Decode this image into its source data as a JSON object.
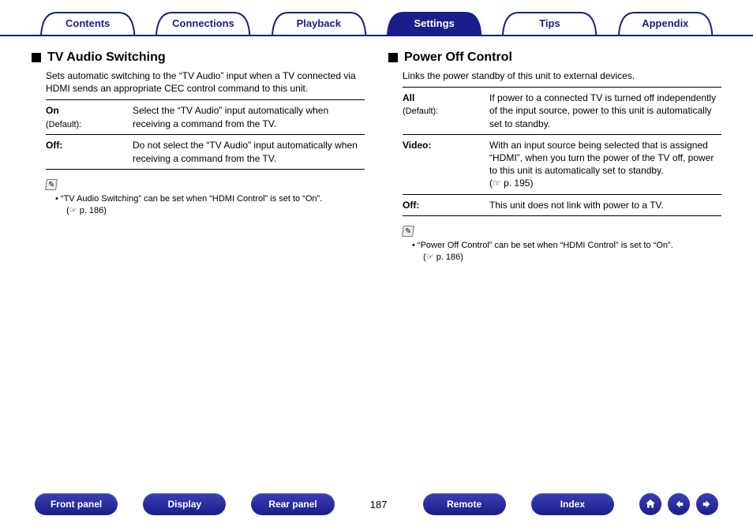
{
  "tabs": {
    "contents": "Contents",
    "connections": "Connections",
    "playback": "Playback",
    "settings": "Settings",
    "tips": "Tips",
    "appendix": "Appendix"
  },
  "left": {
    "title": "TV Audio Switching",
    "intro": "Sets automatic switching to the “TV Audio” input when a TV connected via HDMI sends an appropriate CEC control command to this unit.",
    "rows": [
      {
        "name": "On",
        "default": "(Default):",
        "desc": "Select the “TV Audio” input automatically when receiving a command from the TV."
      },
      {
        "name": "Off:",
        "default": "",
        "desc": "Do not select the “TV Audio” input automatically when receiving a command from the TV."
      }
    ],
    "note": "“TV Audio Switching” can be set when “HDMI Control” is set to “On”.",
    "noteref": "(☞ p. 186)"
  },
  "right": {
    "title": "Power Off Control",
    "intro": "Links the power standby of this unit to external devices.",
    "rows": [
      {
        "name": "All",
        "default": "(Default):",
        "desc": "If power to a connected TV is turned off independently of the input source, power to this unit is automatically set to standby."
      },
      {
        "name": "Video:",
        "default": "",
        "desc": "With an input source being selected that is assigned “HDMI”, when you turn the power of the TV off, power to this unit is automatically set to standby.\n (☞ p. 195)"
      },
      {
        "name": "Off:",
        "default": "",
        "desc": "This unit does not link with power to a TV."
      }
    ],
    "note": "“Power Off Control” can be set when “HDMI Control” is set to “On”.",
    "noteref": "(☞ p. 186)"
  },
  "bottom": {
    "front": "Front panel",
    "display": "Display",
    "rear": "Rear panel",
    "page": "187",
    "remote": "Remote",
    "index": "Index"
  },
  "noteicon": "✎"
}
